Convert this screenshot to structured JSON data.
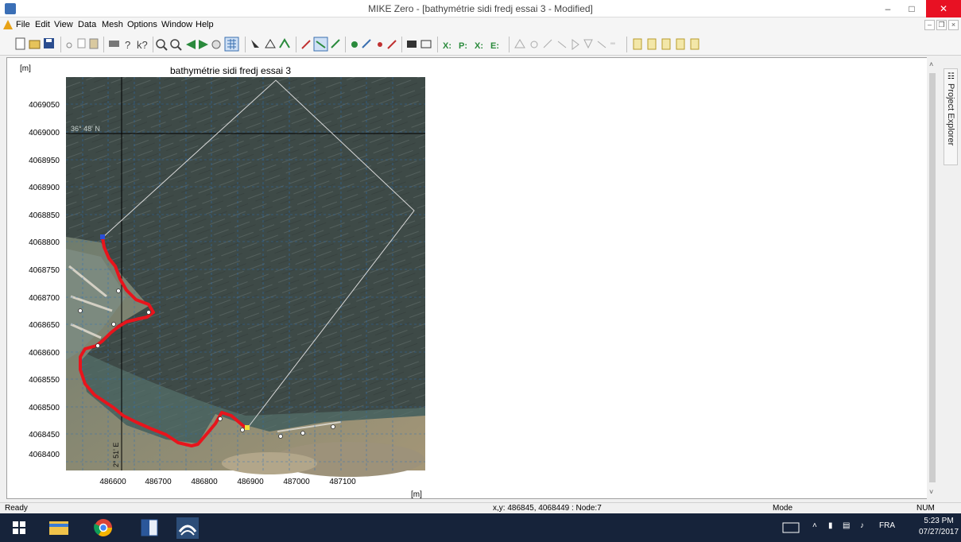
{
  "window": {
    "title": "MIKE Zero - [bathymétrie sidi fredj essai 3 - Modified]",
    "min_glyph": "–",
    "max_glyph": "□",
    "close_glyph": "✕"
  },
  "menu": {
    "items": [
      "File",
      "Edit",
      "View",
      "Data",
      "Mesh",
      "Options",
      "Window",
      "Help"
    ],
    "mdi_min": "–",
    "mdi_restore": "❐",
    "mdi_close": "×"
  },
  "toolbar": {
    "icons": [
      "new-icon",
      "open-icon",
      "save-icon",
      "cut-icon",
      "copy-icon",
      "paste-icon",
      "print-icon",
      "help-icon",
      "context-help-icon",
      "zoom-in-icon",
      "zoom-out-icon",
      "zoom-previous-icon",
      "zoom-next-icon",
      "pan-icon",
      "grid-icon",
      "select-icon",
      "polygon-icon",
      "arc-icon",
      "draw-arc-icon",
      "select-arc-icon",
      "edit-arc-icon",
      "node-icon",
      "move-node-icon",
      "point-icon",
      "pen-icon",
      "find-icon",
      "background-icon",
      "mesh-add-icon",
      "mesh-smooth-icon",
      "mesh-delete-icon",
      "mesh-refine-icon",
      "triangulate-icon",
      "analyze-icon",
      "refine-icon",
      "node-info-icon",
      "interpolate-icon",
      "export-icon",
      "import-icon",
      "data1-icon",
      "data2-icon",
      "data3-icon",
      "data4-icon",
      "data5-icon"
    ]
  },
  "map": {
    "unit_label": "[m]",
    "title": "bathymétrie sidi fredj essai 3",
    "x_unit_label": "[m]",
    "y_ticks": [
      "4069050",
      "4069000",
      "4068950",
      "4068900",
      "4068850",
      "4068800",
      "4068750",
      "4068700",
      "4068650",
      "4068600",
      "4068550",
      "4068500",
      "4068450",
      "4068400"
    ],
    "x_ticks": [
      "486600",
      "486700",
      "486800",
      "486900",
      "487000",
      "487100"
    ],
    "lat_label": "36° 48' N",
    "lon_label": "2° 51' E",
    "colors": {
      "sea": "#3e4a47",
      "shore": "#8a7f66",
      "coastline": "#e8141c",
      "boundary": "#c8c8c8",
      "gridline": "#2b6fb8"
    }
  },
  "explorer": {
    "label": "Project Explorer",
    "icon": "project-explorer-icon"
  },
  "scroll": {
    "up_glyph": "˄",
    "down_glyph": "˅"
  },
  "status": {
    "ready": "Ready",
    "coords": "x,y: 486845, 4068449 :  Node:7",
    "mode": "Mode",
    "num": "NUM"
  },
  "taskbar": {
    "apps": [
      "start-icon",
      "file-explorer-icon",
      "chrome-icon",
      "word-icon",
      "mike-zero-icon"
    ],
    "tray_lang": "FRA",
    "tray_up_glyph": "˄",
    "time": "5:23 PM",
    "date": "07/27/2017"
  }
}
